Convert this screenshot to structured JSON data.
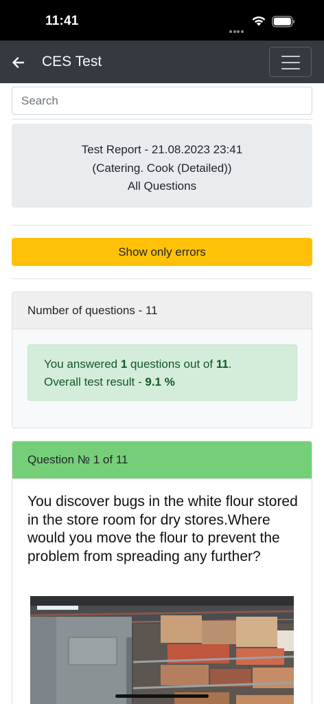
{
  "status_bar": {
    "time": "11:41"
  },
  "navbar": {
    "title": "CES Test"
  },
  "search": {
    "placeholder": "Search"
  },
  "report": {
    "title": "Test Report - 21.08.2023 23:41",
    "subtitle": "(Catering. Cook (Detailed))",
    "scope": "All Questions"
  },
  "filter": {
    "show_errors_label": "Show only errors"
  },
  "summary": {
    "header": "Number of questions - 11",
    "answered_prefix": "You answered ",
    "answered_count": "1",
    "answered_middle": " questions out of ",
    "total_count": "11",
    "answered_suffix": ".",
    "result_prefix": "Overall test result - ",
    "result_value": "9.1 %"
  },
  "question": {
    "header": "Question № 1 of 11",
    "text": "You discover bugs in the white flour stored in the store room for dry stores.Where would you move the flour to prevent the problem from spreading any further?"
  },
  "colors": {
    "navbar": "#343a40",
    "warning": "#ffc107",
    "success_header": "#75cf79",
    "alert_bg": "#d4edda",
    "alert_text": "#155724"
  },
  "icons": {
    "back": "arrow-left-icon",
    "menu": "hamburger-menu-icon",
    "wifi": "wifi-icon",
    "battery": "battery-icon"
  }
}
